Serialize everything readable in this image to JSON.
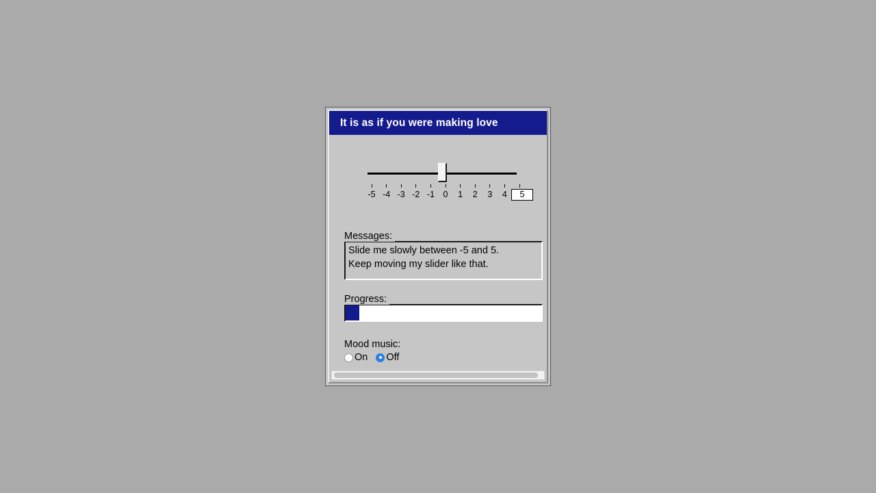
{
  "window": {
    "title": "It is as if you were making love",
    "title_bar_color": "#141b8c",
    "background_color": "#c6c6c6",
    "desktop_color": "#aaaaaa"
  },
  "slider": {
    "value": 0,
    "min": -5,
    "max": 5,
    "ticks": [
      {
        "label": "-5",
        "boxed": false
      },
      {
        "label": "-4",
        "boxed": false
      },
      {
        "label": "-3",
        "boxed": false
      },
      {
        "label": "-2",
        "boxed": false
      },
      {
        "label": "-1",
        "boxed": false
      },
      {
        "label": "0",
        "boxed": false
      },
      {
        "label": "1",
        "boxed": false
      },
      {
        "label": "2",
        "boxed": false
      },
      {
        "label": "3",
        "boxed": false
      },
      {
        "label": "4",
        "boxed": false
      },
      {
        "label": "5",
        "boxed": true
      }
    ]
  },
  "messages": {
    "label": "Messages:",
    "lines": [
      "Slide me slowly between -5 and 5.",
      "Keep moving my slider like that."
    ]
  },
  "progress": {
    "label": "Progress:",
    "percent": 7,
    "fill_color": "#141b8c"
  },
  "mood_music": {
    "label": "Mood music:",
    "selected": "Off",
    "options": [
      {
        "label": "On",
        "checked": false
      },
      {
        "label": "Off",
        "checked": true
      }
    ],
    "accent_color": "#2b7fe8"
  },
  "scrollbar": {
    "orientation": "horizontal",
    "thumb_extent_percent": 98
  }
}
